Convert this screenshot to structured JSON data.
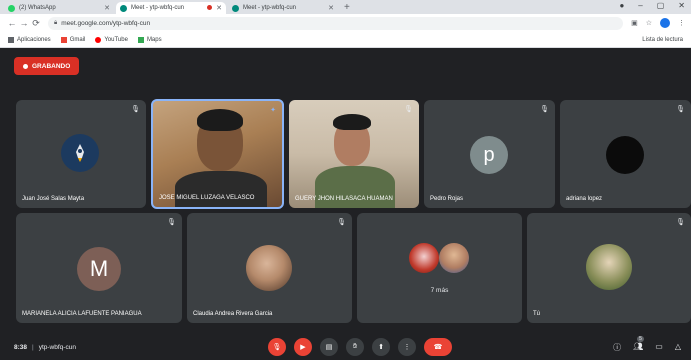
{
  "browser": {
    "tabs": [
      {
        "title": "(2) WhatsApp",
        "favicon_color": "#25d366",
        "active": false
      },
      {
        "title": "Meet - ytp-wbfq-cun",
        "favicon_color": "#00897b",
        "active": true
      },
      {
        "title": "Meet - ytp-wbfq-cun",
        "favicon_color": "#00897b",
        "active": false
      }
    ],
    "new_tab": "+",
    "url": "meet.google.com/ytp-wbfq-cun",
    "bookmarks": [
      {
        "label": "Aplicaciones",
        "icon": "apps-grid-icon",
        "color": "#5f6368"
      },
      {
        "label": "Gmail",
        "icon": "gmail-icon",
        "color": "#ea4335"
      },
      {
        "label": "YouTube",
        "icon": "youtube-icon",
        "color": "#ff0000"
      },
      {
        "label": "Maps",
        "icon": "maps-icon",
        "color": "#34a853"
      }
    ],
    "reading_list": "Lista de lectura"
  },
  "meet": {
    "recording_label": "GRABANDO",
    "participants_row1": [
      {
        "name": "Juan José Salas Mayta",
        "type": "avatar-logo",
        "color": "#1c3a5f"
      },
      {
        "name": "JOSE MIGUEL LUZAGA VELASCO",
        "type": "video",
        "active_speaker": true
      },
      {
        "name": "GUERY JHON HILASACA HUAMAN",
        "type": "video"
      },
      {
        "name": "Pedro Rojas",
        "type": "letter",
        "letter": "p",
        "color": "#7f8c8d"
      },
      {
        "name": "adriana lopez",
        "type": "letter",
        "letter": "",
        "color": "#0b0b0b"
      }
    ],
    "participants_row2": [
      {
        "name": "MARIANELA ALICIA LAFUENTE PANIAGUA",
        "type": "letter",
        "letter": "M",
        "color": "#7d5f56"
      },
      {
        "name": "Claudia Andrea Rivera Garcia",
        "type": "photo",
        "color": "#b58a6b"
      },
      {
        "name": "",
        "type": "group",
        "more_label": "7 más",
        "colors": [
          "#c0392b",
          "#b07d62"
        ]
      },
      {
        "name": "Tú",
        "type": "photo",
        "color": "#8a8f5a"
      }
    ],
    "bottom": {
      "time": "8:38",
      "meeting_code": "ytp-wbfq-cun",
      "participant_count": "5"
    },
    "colors": {
      "accent_red": "#ea4335",
      "active_border": "#8ab4f8",
      "tile_bg": "#3c4043",
      "bg": "#202124"
    }
  }
}
